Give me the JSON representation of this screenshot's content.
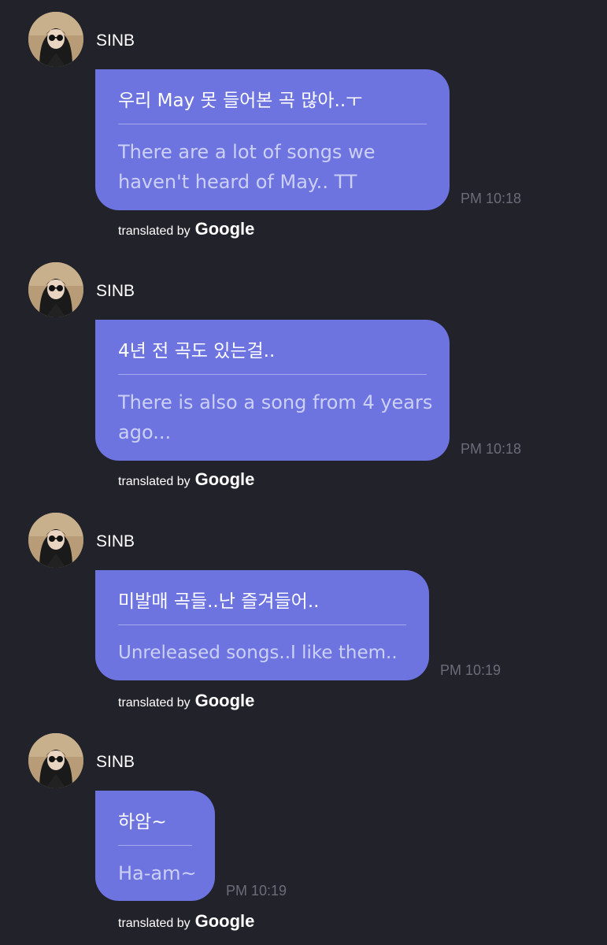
{
  "messages": [
    {
      "sender": "SINB",
      "original": "우리 May 못 들어본 곡 많아..ㅜ",
      "translation": "There are a lot of songs we haven't heard of May.. TT",
      "time": "PM 10:18",
      "translated_by": "translated by",
      "google": "Google"
    },
    {
      "sender": "SINB",
      "original": "4년 전 곡도 있는걸..",
      "translation": "There is also a song from 4 years ago...",
      "time": "PM 10:18",
      "translated_by": "translated by",
      "google": "Google"
    },
    {
      "sender": "SINB",
      "original": "미발매 곡들..난 즐겨들어..",
      "translation": "Unreleased songs..I like them..",
      "time": "PM 10:19",
      "translated_by": "translated by",
      "google": "Google"
    },
    {
      "sender": "SINB",
      "original": "하암~",
      "translation": "Ha-am~",
      "time": "PM 10:19",
      "translated_by": "translated by",
      "google": "Google"
    }
  ]
}
